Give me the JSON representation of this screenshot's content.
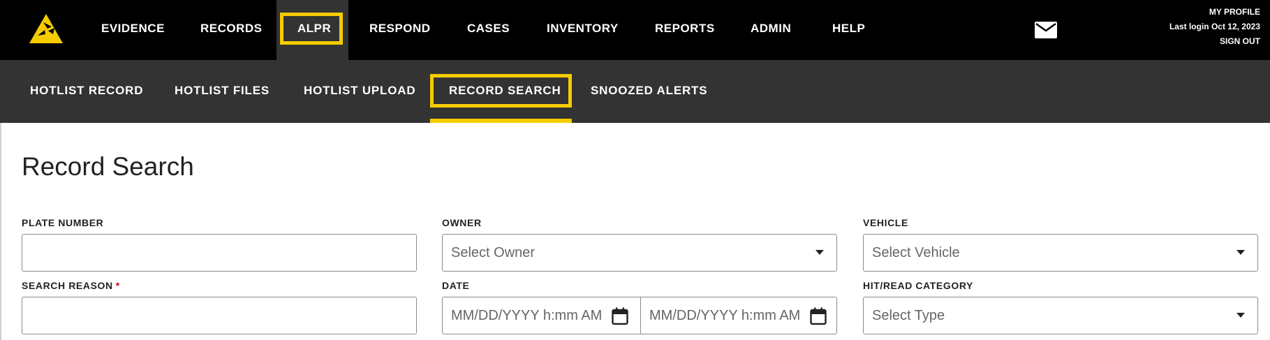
{
  "topnav": {
    "items": [
      {
        "label": "EVIDENCE"
      },
      {
        "label": "RECORDS"
      },
      {
        "label": "ALPR"
      },
      {
        "label": "RESPOND"
      },
      {
        "label": "CASES"
      },
      {
        "label": "INVENTORY"
      },
      {
        "label": "REPORTS"
      },
      {
        "label": "ADMIN"
      },
      {
        "label": "HELP"
      }
    ],
    "active": "ALPR"
  },
  "profile": {
    "my_profile": "MY PROFILE",
    "last_login": "Last login Oct 12, 2023",
    "sign_out": "SIGN OUT"
  },
  "subnav": {
    "items": [
      {
        "label": "HOTLIST RECORD"
      },
      {
        "label": "HOTLIST FILES"
      },
      {
        "label": "HOTLIST UPLOAD"
      },
      {
        "label": "RECORD SEARCH"
      },
      {
        "label": "SNOOZED ALERTS"
      }
    ],
    "active": "RECORD SEARCH"
  },
  "page": {
    "title": "Record Search"
  },
  "form": {
    "plate_number": {
      "label": "PLATE NUMBER",
      "value": ""
    },
    "owner": {
      "label": "OWNER",
      "placeholder": "Select Owner"
    },
    "vehicle": {
      "label": "VEHICLE",
      "placeholder": "Select Vehicle"
    },
    "search_reason": {
      "label": "SEARCH REASON",
      "required_mark": "*",
      "value": ""
    },
    "date": {
      "label": "DATE",
      "start_placeholder": "MM/DD/YYYY h:mm AM",
      "end_placeholder": "MM/DD/YYYY h:mm AM"
    },
    "hit_read_category": {
      "label": "HIT/READ CATEGORY",
      "placeholder": "Select Type"
    }
  },
  "colors": {
    "highlight": "#f5cc00",
    "topbar": "#000000",
    "subbar": "#333333",
    "required": "#d0021b"
  },
  "icons": [
    "logo-icon",
    "mail-icon",
    "chevron-down-icon",
    "calendar-icon"
  ]
}
